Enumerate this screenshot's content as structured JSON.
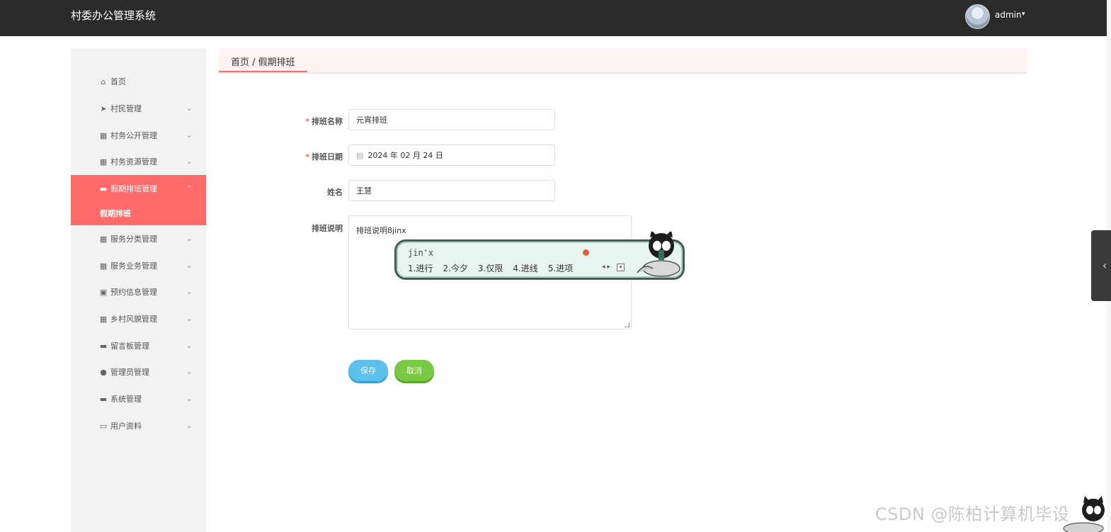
{
  "header": {
    "title": "村委办公管理系统",
    "user_name": "admin",
    "user_caret": "▾"
  },
  "sidebar": {
    "items": [
      {
        "label": "首页",
        "icon": "home-icon",
        "glyph": "⌂",
        "arrow": ""
      },
      {
        "label": "村民管理",
        "icon": "send-icon",
        "glyph": "➤",
        "arrow": "⌄"
      },
      {
        "label": "村务公开管理",
        "icon": "grid-icon",
        "glyph": "▦",
        "arrow": "⌄"
      },
      {
        "label": "村务资源管理",
        "icon": "grid-icon",
        "glyph": "▦",
        "arrow": "⌄"
      },
      {
        "label": "假期排班管理",
        "icon": "comment-icon",
        "glyph": "▬",
        "arrow": "⌃"
      },
      {
        "label": "服务分类管理",
        "icon": "grid-icon",
        "glyph": "▦",
        "arrow": "⌄"
      },
      {
        "label": "服务业务管理",
        "icon": "grid-icon",
        "glyph": "▦",
        "arrow": "⌄"
      },
      {
        "label": "预约信息管理",
        "icon": "clipboard-icon",
        "glyph": "▣",
        "arrow": "⌄"
      },
      {
        "label": "乡村风貌管理",
        "icon": "grid-icon",
        "glyph": "▦",
        "arrow": "⌄"
      },
      {
        "label": "留言板管理",
        "icon": "message-icon",
        "glyph": "▬",
        "arrow": "⌄"
      },
      {
        "label": "管理员管理",
        "icon": "location-icon",
        "glyph": "●",
        "arrow": "⌄"
      },
      {
        "label": "系统管理",
        "icon": "monitor-icon",
        "glyph": "▬",
        "arrow": "⌄"
      },
      {
        "label": "用户资料",
        "icon": "card-icon",
        "glyph": "▭",
        "arrow": "⌄"
      }
    ],
    "submenu": {
      "label": "假期排班"
    },
    "active_index": 4
  },
  "breadcrumb": {
    "text": "首页 / 假期排班"
  },
  "form": {
    "name_label": "排班名称",
    "name_value": "元宵排班",
    "date_label": "排班日期",
    "date_value": "2024 年 02 月 24 日",
    "person_label": "姓名",
    "person_value": "王慧",
    "desc_label": "排班说明",
    "desc_value": "排班说明8jinx",
    "required_mark": "*",
    "save_label": "保存",
    "cancel_label": "取消"
  },
  "ime": {
    "composition": "jin'x",
    "candidates": [
      "1.进行",
      "2.今夕",
      "3.仅限",
      "4.进线",
      "5.进项"
    ],
    "nav": "◂ ▸",
    "menu": "▾"
  },
  "watermark": "CSDN @陈柏计算机毕设",
  "colors": {
    "accent": "#ff6a6a",
    "save": "#5bc0eb",
    "cancel": "#7ac943",
    "topbar": "#2b2b2b"
  }
}
